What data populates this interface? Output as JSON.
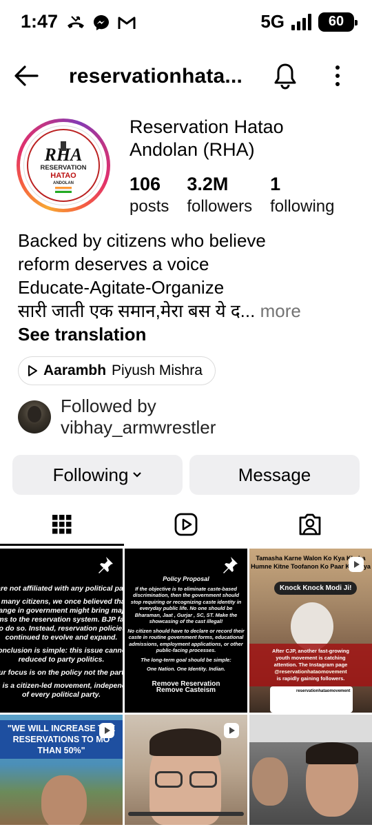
{
  "status_bar": {
    "time": "1:47",
    "network": "5G",
    "battery": "60",
    "notif_icons": [
      "missed-call-icon",
      "messenger-icon",
      "gmail-icon"
    ]
  },
  "header": {
    "username": "reservationhata...",
    "icons": [
      "back-arrow-icon",
      "bell-icon",
      "more-vertical-icon"
    ]
  },
  "profile": {
    "display_name": "Reservation Hatao Andolan  (RHA)",
    "avatar_logo": {
      "abbr": "RHA",
      "line1": "RESERVATION",
      "line2": "HATAO",
      "line3": "ANDOLAN"
    },
    "stats": [
      {
        "value": "106",
        "label": "posts"
      },
      {
        "value": "3.2M",
        "label": "followers"
      },
      {
        "value": "1",
        "label": "following"
      }
    ],
    "bio_lines": [
      "Backed by citizens who believe",
      "reform deserves a voice",
      "Educate-Agitate-Organize",
      "सारी जाती एक समान,मेरा बस ये द..."
    ],
    "bio_more": "more",
    "see_translation": "See translation",
    "music": {
      "title": "Aarambh",
      "artist": "Piyush Mishra"
    },
    "followed_by": {
      "label": "Followed by",
      "user": "vibhay_armwrestler"
    }
  },
  "actions": {
    "following_label": "Following",
    "message_label": "Message"
  },
  "tabs": [
    "grid-icon",
    "reels-icon",
    "tagged-icon"
  ],
  "posts": [
    {
      "type": "text",
      "pinned": true,
      "lines": [
        "are not affiliated with any political par",
        "",
        "e many citizens, we once believed that",
        "hange in government might bring majo",
        "rms to the reservation system. BJP fail",
        "to do so. Instead, reservation policies",
        "continued to evolve and expand.",
        "",
        "conclusion is simple: this issue cannot",
        "reduced to party politics.",
        "",
        "Our focus is on the policy not the party.",
        "",
        "s is a citizen-led movement, independ",
        "of every political party."
      ]
    },
    {
      "type": "text",
      "pinned": true,
      "title": "Policy Proposal",
      "lines": [
        "If the objective is to eliminate caste-based",
        "discrimination, then the government should",
        "stop requiring or recognizing caste identity in",
        "everyday public life. No one should be",
        "Bharaman, Jaat , Gurjar , SC, ST.  Make the",
        "showcasing of the cast illegal!",
        "",
        "No citizen should have to declare or record their",
        "caste in routine government forms, educational",
        "admissions, employment applications, or other",
        "public-facing processes.",
        "",
        "The long-term goal should be simple:",
        "",
        "One Nation. One Identity. Indian."
      ],
      "footer": [
        "Remove Reservation",
        "Remove Casteism"
      ]
    },
    {
      "type": "reel",
      "headline": [
        "Tamasha Karne Walon Ko Kya Khaba",
        "Humne Kitne Toofanon Ko Paar Kar Diya"
      ],
      "bubble": "Knock Knock Modi Ji!",
      "caption": [
        "After CJP, another fast-growing",
        "youth movement is catching",
        "attention. The Instagram page",
        "@reservationhataomovement",
        "is rapidly gaining followers."
      ],
      "card_handle": "reservationhataomovement"
    },
    {
      "type": "reel",
      "headline": [
        "\"WE WILL INCREASE THE",
        "RESERVATIONS TO MO",
        "THAN 50%\""
      ]
    },
    {
      "type": "reel"
    },
    {
      "type": "reel"
    }
  ]
}
